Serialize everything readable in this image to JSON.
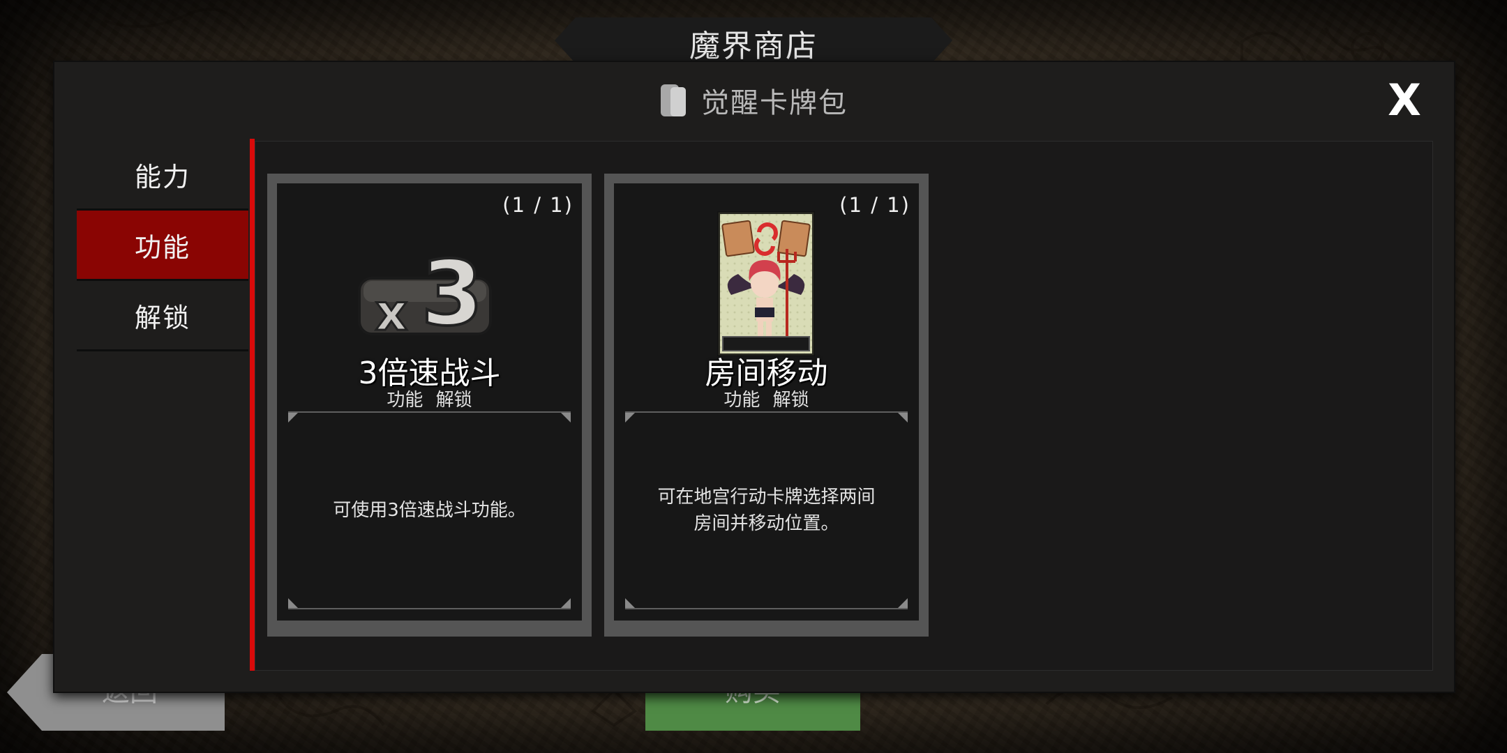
{
  "shop": {
    "title": "魔界商店",
    "back_label": "返回",
    "buy_label": "购买"
  },
  "modal": {
    "title": "觉醒卡牌包",
    "pack_icon": "card-pack-icon",
    "close_label": "X"
  },
  "tabs": [
    {
      "label": "能力",
      "active": false
    },
    {
      "label": "功能",
      "active": true
    },
    {
      "label": "解锁",
      "active": false
    }
  ],
  "cards": [
    {
      "count": "(1 / 1)",
      "name": "3倍速战斗",
      "tags": "功能 解锁",
      "description": "可使用3倍速战斗功能。",
      "icon": "x3-speed-icon",
      "icon_text": {
        "prefix": "x",
        "number": "3"
      }
    },
    {
      "count": "(1 / 1)",
      "name": "房间移动",
      "tags": "功能 解锁",
      "description": "可在地宫行动卡牌选择两间房间并移动位置。",
      "icon": "room-move-card-icon"
    }
  ],
  "colors": {
    "accent_red": "#d90a0a",
    "active_tab": "#8a0503",
    "buy_green": "#4f8a45"
  }
}
